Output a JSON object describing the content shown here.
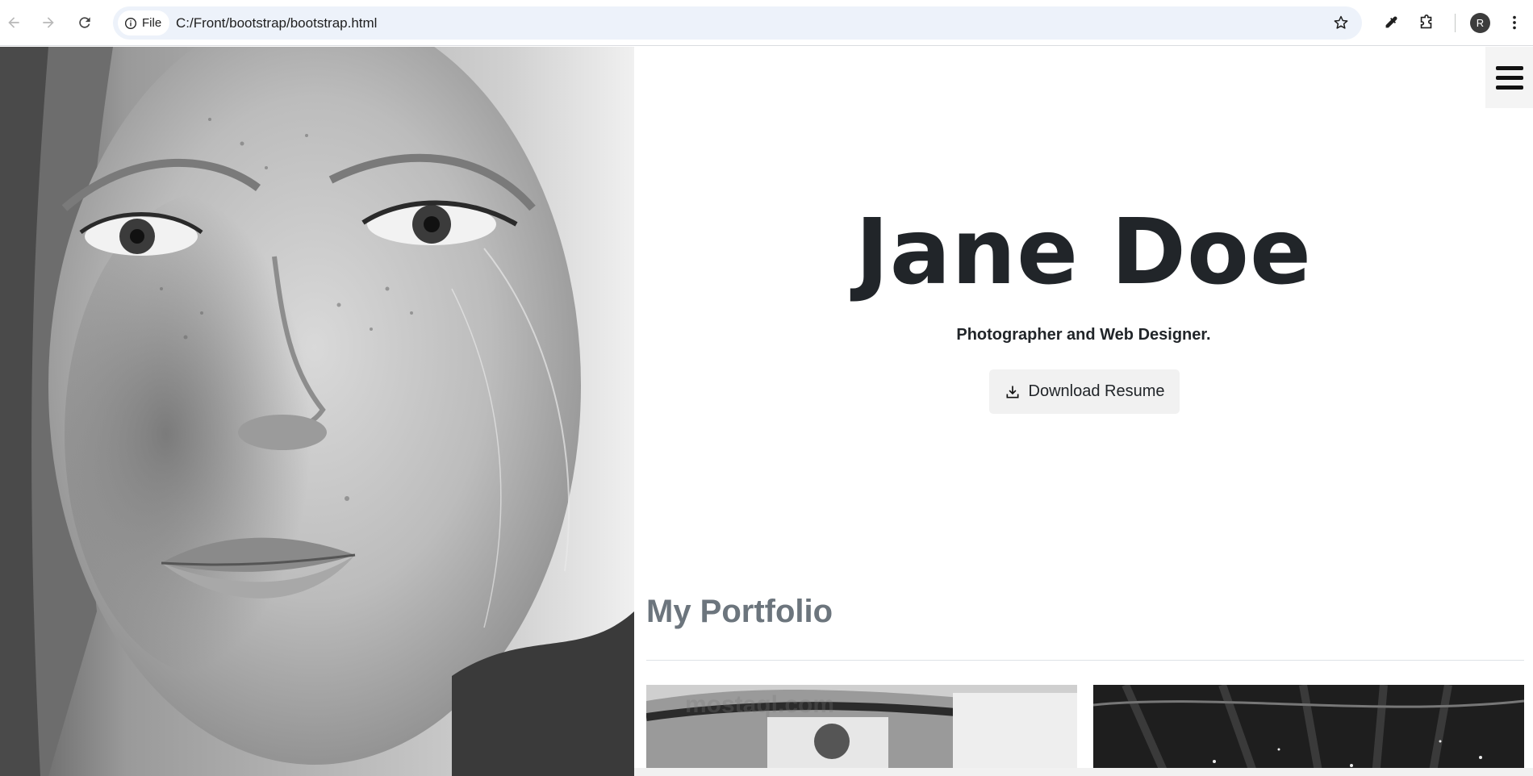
{
  "browser": {
    "site_chip_label": "File",
    "url": "C:/Front/bootstrap/bootstrap.html",
    "profile_initial": "R",
    "icons": [
      "back-arrow-icon",
      "forward-arrow-icon",
      "reload-icon",
      "info-icon",
      "star-icon",
      "eyedropper-icon",
      "extensions-icon",
      "kebab-menu-icon"
    ]
  },
  "hero": {
    "name": "Jane Doe",
    "tagline": "Photographer and Web Designer.",
    "resume_button_label": "Download Resume",
    "resume_icon": "download-icon",
    "menu_icon": "hamburger-menu-icon"
  },
  "portfolio": {
    "title": "My Portfolio",
    "watermark": "mostaql.com"
  },
  "colors": {
    "heading": "#212529",
    "muted": "#6c757d",
    "button_bg": "#f1f1f1",
    "omnibox_bg": "#edf2fa"
  }
}
